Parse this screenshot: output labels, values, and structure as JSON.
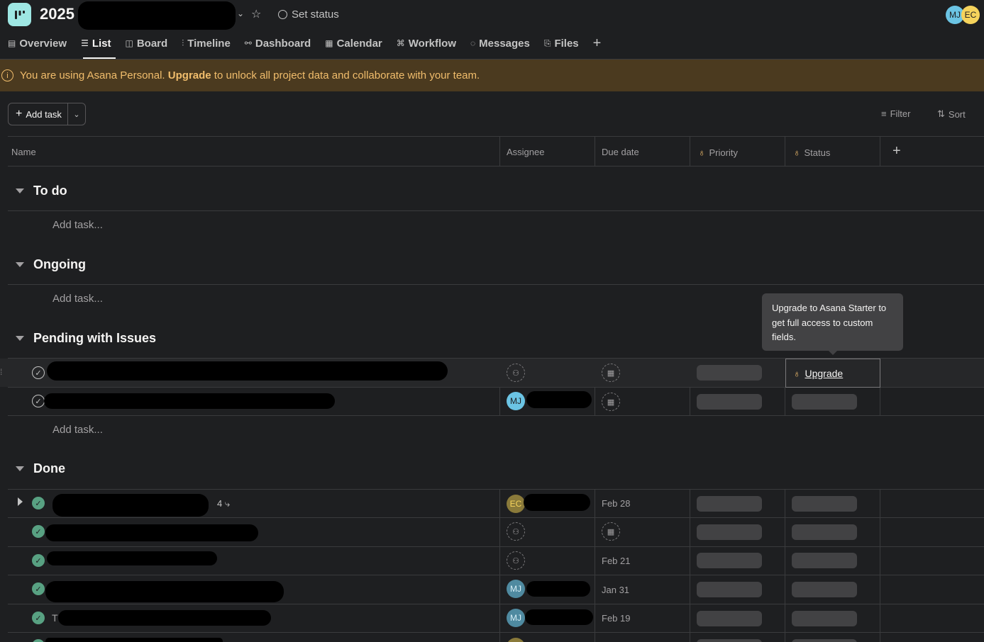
{
  "header": {
    "project_title": "2025",
    "set_status_label": "Set status",
    "avatars": [
      {
        "initials": "MJ",
        "color": "#6bc4e4"
      },
      {
        "initials": "EC",
        "color": "#f5d35c"
      }
    ]
  },
  "tabs": [
    {
      "label": "Overview",
      "icon": "overview-icon",
      "glyph": "▤",
      "active": false
    },
    {
      "label": "List",
      "icon": "list-icon",
      "glyph": "☰",
      "active": true
    },
    {
      "label": "Board",
      "icon": "board-icon",
      "glyph": "◫",
      "active": false
    },
    {
      "label": "Timeline",
      "icon": "timeline-icon",
      "glyph": "⫶",
      "active": false
    },
    {
      "label": "Dashboard",
      "icon": "dashboard-icon",
      "glyph": "⚯",
      "active": false
    },
    {
      "label": "Calendar",
      "icon": "calendar-icon",
      "glyph": "▦",
      "active": false
    },
    {
      "label": "Workflow",
      "icon": "workflow-icon",
      "glyph": "⌘",
      "active": false
    },
    {
      "label": "Messages",
      "icon": "messages-icon",
      "glyph": "◌",
      "active": false
    },
    {
      "label": "Files",
      "icon": "files-icon",
      "glyph": "⎘",
      "active": false
    }
  ],
  "banner": {
    "text_before": "You are using Asana Personal.",
    "link": "Upgrade",
    "text_after": "to unlock all project data and collaborate with your team."
  },
  "toolbar": {
    "add_task_label": "Add task",
    "filter_label": "Filter",
    "sort_label": "Sort"
  },
  "columns": {
    "name": "Name",
    "assignee": "Assignee",
    "due_date": "Due date",
    "priority": "Priority",
    "status": "Status"
  },
  "sections": {
    "todo": {
      "title": "To do",
      "add_task": "Add task..."
    },
    "ongoing": {
      "title": "Ongoing",
      "add_task": "Add task..."
    },
    "pending": {
      "title": "Pending with Issues",
      "add_task": "Add task..."
    },
    "done": {
      "title": "Done"
    }
  },
  "tooltip": {
    "text": "Upgrade to Asana Starter to get full access to custom fields."
  },
  "upgrade_cell": {
    "label": "Upgrade"
  },
  "pending_rows": [
    {
      "assignee_initials": "",
      "due": ""
    },
    {
      "assignee_initials": "MJ",
      "due": ""
    }
  ],
  "done_rows": [
    {
      "subtasks": "4",
      "assignee_initials": "EC",
      "due": "Feb 28",
      "partial_text": ""
    },
    {
      "subtasks": "",
      "assignee_initials": "",
      "due": "",
      "partial_text": ""
    },
    {
      "subtasks": "",
      "assignee_initials": "",
      "due": "Feb 21",
      "partial_text": ""
    },
    {
      "subtasks": "",
      "assignee_initials": "MJ",
      "due": "Jan 31",
      "partial_text": ""
    },
    {
      "subtasks": "",
      "assignee_initials": "MJ",
      "due": "Feb 19",
      "partial_text": "T"
    }
  ]
}
